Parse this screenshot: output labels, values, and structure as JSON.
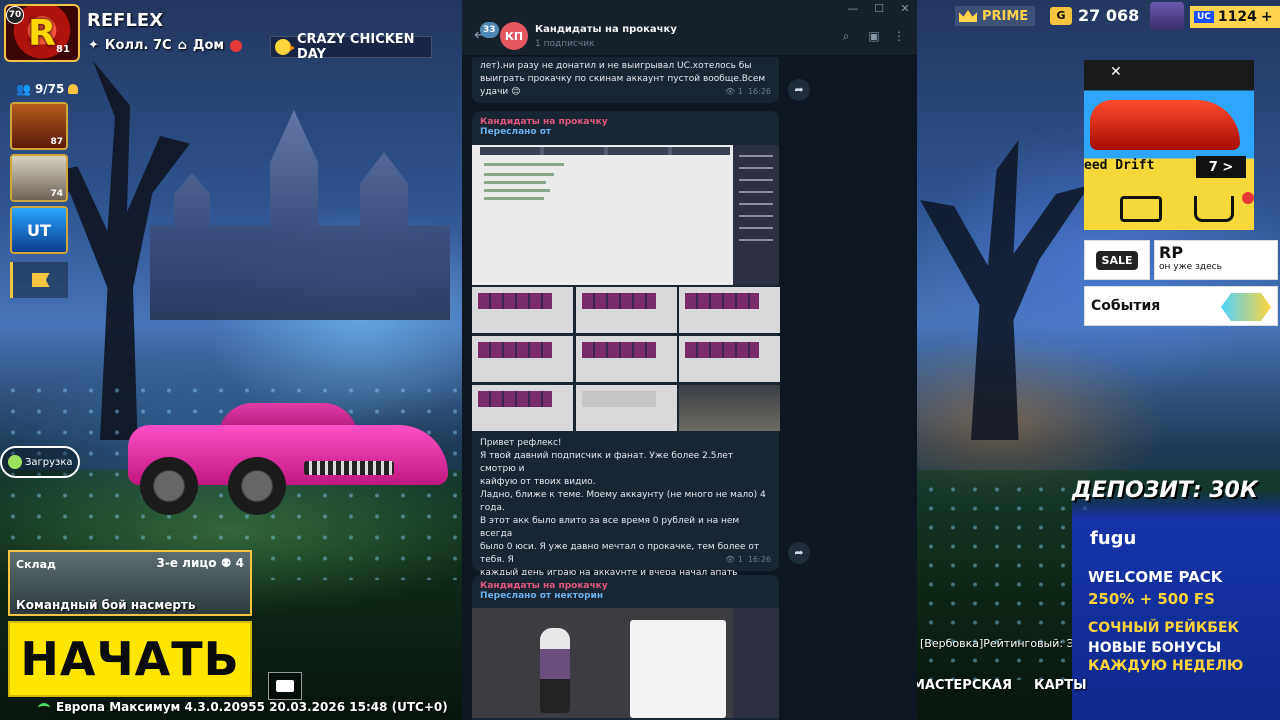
{
  "game": {
    "player_name": "REFLEX",
    "level": "70",
    "avatar_letter": "R",
    "avatar_rank": "81",
    "clan": "Колл. 7С",
    "home": "Дом",
    "event_banner": "CRAZY CHICKEN DAY",
    "friends_count": "9/75",
    "side_thumbs": [
      {
        "n": "87"
      },
      {
        "n": "74"
      },
      {
        "n": "UT"
      }
    ],
    "loading_label": "Загрузка",
    "map_name": "Склад",
    "perspective": "3-е лицо",
    "squad_size": "4",
    "mode_name": "Командный бой насмерть",
    "start_label": "НАЧАТЬ",
    "status_line": "Европа  Максимум  4.3.0.20955 20.03.2026 15:48 (UTC+0)",
    "prime_label": "PRIME",
    "gold_amount": "27 068",
    "gold_icon": "G",
    "uc_amount": "1124",
    "uc_label": "UC",
    "promo_title": "eed Drift",
    "promo_page": "7 >",
    "sale_label": "SALE",
    "rp_title": "RP",
    "rp_sub": "он уже здесь",
    "events_label": "События",
    "ticker": "[Вербовка]Рейтинговый: Эранге",
    "nav_items": [
      "МАСТЕРСКАЯ",
      "КАРТЫ"
    ]
  },
  "ad": {
    "deposit": "ДЕПОЗИТ: 30К",
    "brand": "fugu",
    "line1": "WELCOME PACK",
    "line2": "250% + 500 FS",
    "line3": "СОЧНЫЙ РЕЙКБЕК",
    "line4": "НОВЫЕ БОНУСЫ",
    "line5": "КАЖДУЮ НЕДЕЛЮ"
  },
  "telegram": {
    "unread_count": "33",
    "channel_initials": "КП",
    "channel_title": "Кандидаты на прокачку",
    "subscribers": "1 подписчик",
    "messages": [
      {
        "text": "лет).ни разу не донатил и не выигрывал UC.хотелось бы\nвыиграть прокачку по скинам аккаунт пустой вообще.Всем\nудачи 😊",
        "views": "1",
        "time": "16:26"
      },
      {
        "from": "Кандидаты на прокачку",
        "forwarded": "Переслано от",
        "text": "Привет рефлекс!\nЯ твой давний подписчик и фанат. Уже более 2.5лет смотрю и\nкайфую от твоих видио.\nЛадно, ближе к теме. Моему аккаунту (не много не мало) 4 года.\nВ этот акк было влито за все время 0 рублей и на нем всегда\nбыло 0 юси. Я уже давно мечтал о прокачке, тем более от тебя. Я\nкаждый день играю на аккаунте и вчера начал апать своего\nпервого завоевателя.\nОчень надеюсь что ты меня увидишь на стриме и мой акк пудет\nподходить по параметрам!",
        "views": "1",
        "time": "16:26"
      },
      {
        "from": "Кандидаты на прокачку",
        "forwarded": "Переслано от некторин"
      }
    ]
  }
}
